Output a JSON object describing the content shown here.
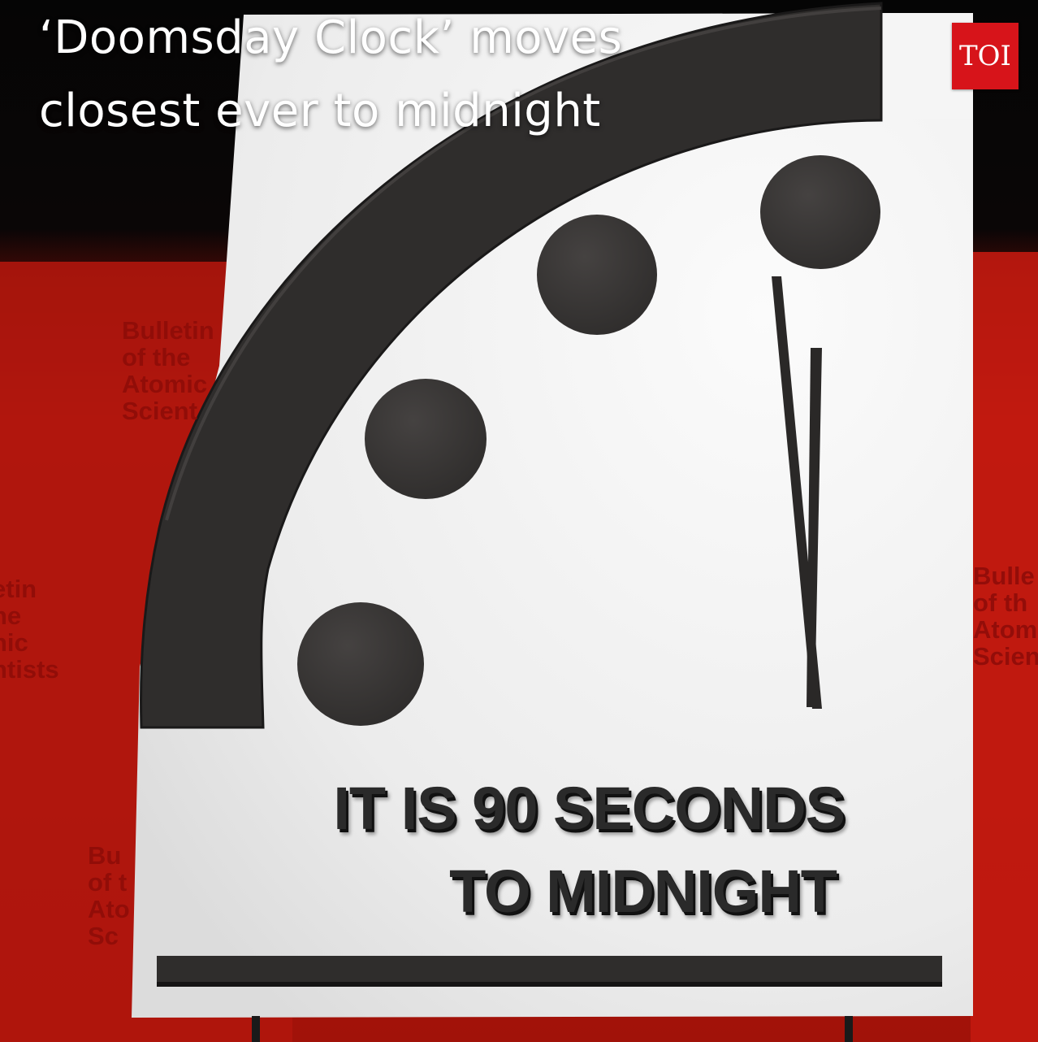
{
  "headline": {
    "line1": "‘Doomsday Clock’ moves",
    "line2": "closest ever to midnight"
  },
  "badge": {
    "label": "TOI",
    "color": "#d7141a"
  },
  "backdrop": {
    "banner_lines": [
      "Bulletin",
      "of the",
      "Atomic",
      "Scientists"
    ],
    "banner_left_top": [
      "Bulletin",
      "of the",
      "Atomic",
      "Scient"
    ],
    "banner_left_mid": [
      "etin",
      "ne",
      "nic",
      "ntists"
    ],
    "banner_left_bot": [
      "Bu",
      "of t",
      "Ato",
      "Sc"
    ],
    "banner_right": [
      "Bulle",
      "of th",
      "Atom",
      "Scien"
    ],
    "color": "#b5140e"
  },
  "clock": {
    "message_line1": "IT IS 90  SECONDS",
    "message_line2": "TO MIDNIGHT",
    "face_color": "#f2f2f2",
    "mark_color": "#3a3837"
  }
}
